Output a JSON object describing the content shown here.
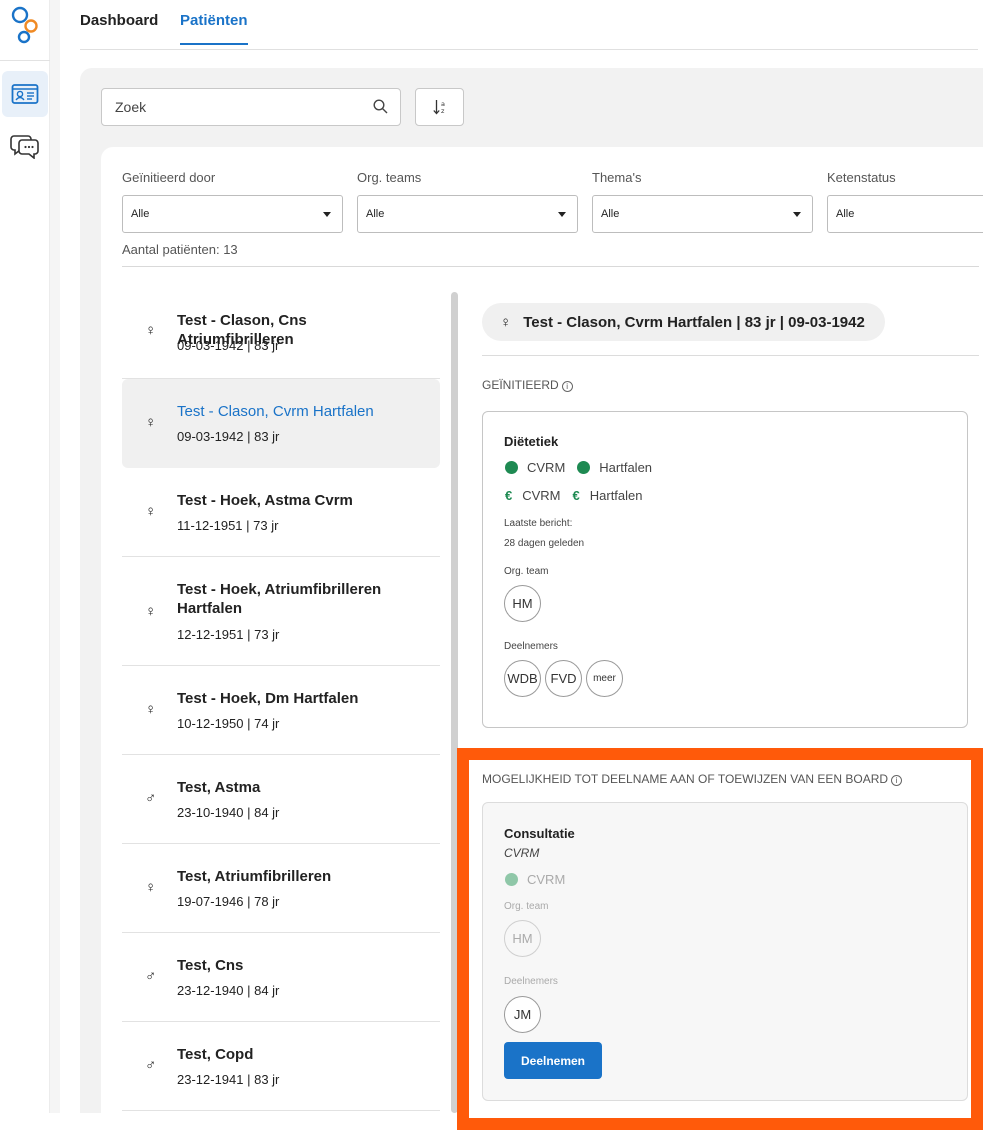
{
  "nav": {
    "tabs": [
      "Dashboard",
      "Patiënten"
    ],
    "active_tab": 1
  },
  "search": {
    "placeholder": "Zoek"
  },
  "filters": [
    {
      "label": "Geïnitieerd door",
      "value": "Alle"
    },
    {
      "label": "Org. teams",
      "value": "Alle"
    },
    {
      "label": "Thema's",
      "value": "Alle"
    },
    {
      "label": "Ketenstatus",
      "value": "Alle"
    }
  ],
  "patient_count": "Aantal patiënten: 13",
  "patients": [
    {
      "name": "Test - Clason, Cns Atriumfibrilleren",
      "dob": "09-03-1942 | 83 jr",
      "gender": "♀",
      "selected": false
    },
    {
      "name": "Test - Clason, Cvrm Hartfalen",
      "dob": "09-03-1942 | 83 jr",
      "gender": "♀",
      "selected": true
    },
    {
      "name": "Test - Hoek, Astma Cvrm",
      "dob": "11-12-1951 | 73 jr",
      "gender": "♀",
      "selected": false
    },
    {
      "name": "Test - Hoek, Atriumfibrilleren Hartfalen",
      "dob": "12-12-1951 | 73 jr",
      "gender": "♀",
      "selected": false
    },
    {
      "name": "Test - Hoek, Dm Hartfalen",
      "dob": "10-12-1950 | 74 jr",
      "gender": "♀",
      "selected": false
    },
    {
      "name": "Test, Astma",
      "dob": "23-10-1940 | 84 jr",
      "gender": "♂",
      "selected": false
    },
    {
      "name": "Test, Atriumfibrilleren",
      "dob": "19-07-1946 | 78 jr",
      "gender": "♀",
      "selected": false
    },
    {
      "name": "Test, Cns",
      "dob": "23-12-1940 | 84 jr",
      "gender": "♂",
      "selected": false
    },
    {
      "name": "Test, Copd",
      "dob": "23-12-1941 | 83 jr",
      "gender": "♂",
      "selected": false
    }
  ],
  "detail": {
    "header": "Test - Clason, Cvrm Hartfalen | 83 jr | 09-03-1942",
    "header_gender": "♀",
    "initiated_label": "GEÏNITIEERD",
    "initiated_card": {
      "title": "Diëtetiek",
      "tags": [
        "CVRM",
        "Hartfalen"
      ],
      "funding": [
        "CVRM",
        "Hartfalen"
      ],
      "last_message_label": "Laatste bericht:",
      "last_message_value": "28 dagen geleden",
      "org_team_label": "Org. team",
      "org_team": [
        "HM"
      ],
      "participants_label": "Deelnemers",
      "participants": [
        "WDB",
        "FVD",
        "meer"
      ]
    },
    "opportunity_label": "MOGELIJKHEID TOT DEELNAME AAN OF TOEWIJZEN VAN EEN BOARD",
    "opportunity_card": {
      "title": "Consultatie",
      "subtitle": "CVRM",
      "tags": [
        "CVRM"
      ],
      "org_team_label": "Org. team",
      "org_team": [
        "HM"
      ],
      "participants_label": "Deelnemers",
      "participants": [
        "JM"
      ],
      "button": "Deelnemen"
    }
  },
  "colors": {
    "accent": "#1a73c8",
    "status_green": "#1e8a52",
    "highlight": "#ff5a0a"
  }
}
